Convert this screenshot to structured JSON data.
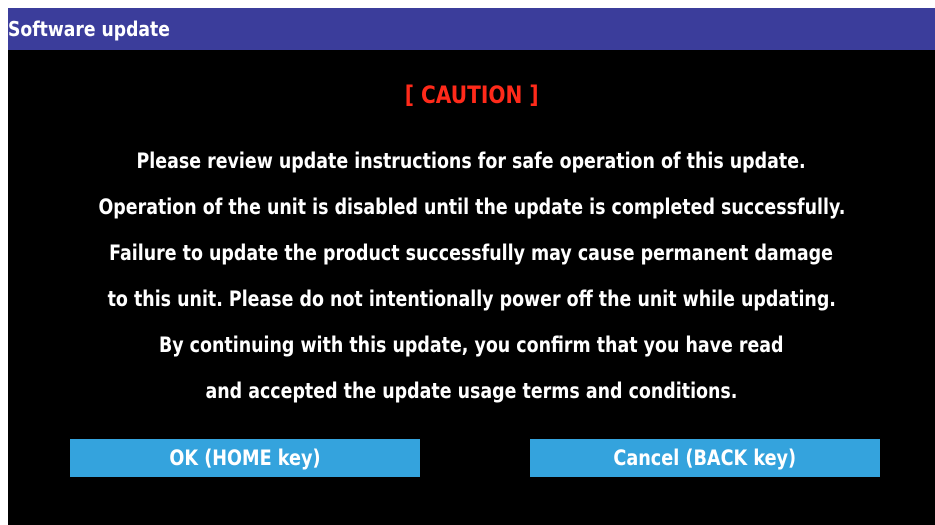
{
  "window": {
    "title": "Software update"
  },
  "caution": {
    "label": "[ CAUTION ]"
  },
  "message": {
    "lines": [
      "Please review update instructions for safe operation of this update.",
      "Operation of the unit is disabled until the update is completed successfully.",
      "Failure to update the product successfully may cause permanent damage",
      "to this unit. Please do not intentionally power off the unit while updating.",
      "By continuing with this update, you confirm that you have read",
      "and accepted the update usage terms and conditions."
    ]
  },
  "buttons": {
    "ok_label": "OK (HOME key)",
    "cancel_label": "Cancel (BACK key)"
  },
  "colors": {
    "title_bar": "#3b3d9b",
    "background": "#000000",
    "caution_text": "#ff2a1a",
    "button": "#34a3dd",
    "text": "#ffffff"
  }
}
